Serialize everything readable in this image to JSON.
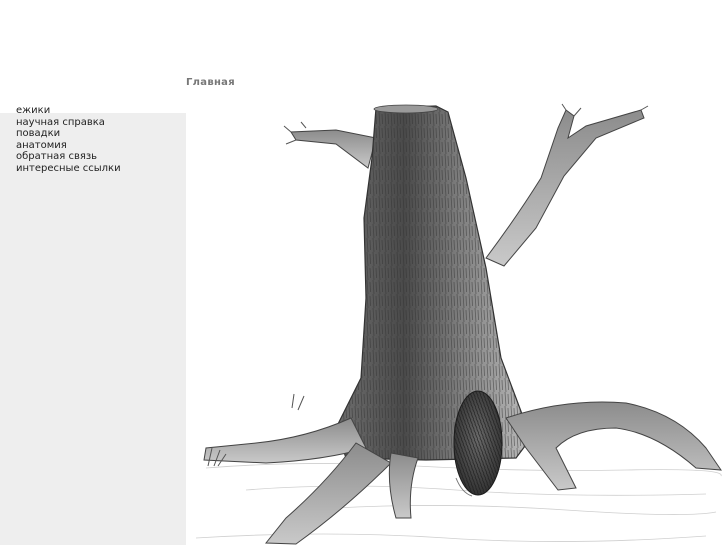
{
  "header": {
    "title": "Главная"
  },
  "sidebar": {
    "items": [
      {
        "label": "ежики"
      },
      {
        "label": "научная справка"
      },
      {
        "label": "повадки"
      },
      {
        "label": "анатомия"
      },
      {
        "label": "обратная связь"
      },
      {
        "label": "интересные ссылки"
      }
    ]
  },
  "main": {
    "illustration": "tree-stump-with-hedgehog-pencil-drawing"
  },
  "colors": {
    "sidebar_bg": "#eeeeee",
    "title_text": "#777777",
    "nav_text": "#222222"
  }
}
